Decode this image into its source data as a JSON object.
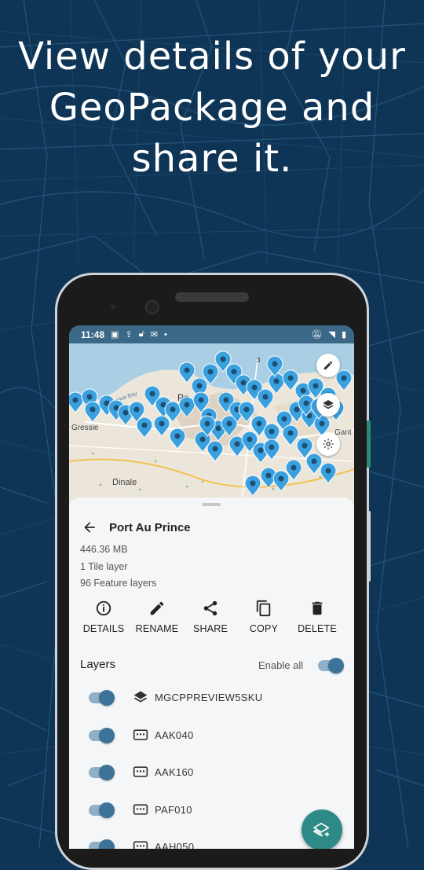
{
  "headline": {
    "line1": "View details of your",
    "line2": "GeoPackage and",
    "line3": "share it."
  },
  "status_bar": {
    "time": "11:48"
  },
  "map": {
    "labels": {
      "town1": "Po",
      "town2": "Gressie",
      "town3": "Dinale",
      "town4": "Gant",
      "road": "3",
      "bay": "Port-au-Prince Bay"
    }
  },
  "details": {
    "title": "Port Au Prince",
    "size": "446.36 MB",
    "tile_layers": "1 Tile layer",
    "feature_layers": "96 Feature layers"
  },
  "actions": [
    {
      "label": "DETAILS",
      "icon": "info-icon"
    },
    {
      "label": "RENAME",
      "icon": "pencil-icon"
    },
    {
      "label": "SHARE",
      "icon": "share-icon"
    },
    {
      "label": "COPY",
      "icon": "copy-icon"
    },
    {
      "label": "DELETE",
      "icon": "trash-icon"
    }
  ],
  "layers": {
    "heading": "Layers",
    "enable_all_label": "Enable all",
    "enable_all_on": true,
    "items": [
      {
        "name": "MGCPPREVIEW5SKU",
        "type": "tile",
        "enabled": true
      },
      {
        "name": "AAK040",
        "type": "feature",
        "enabled": true
      },
      {
        "name": "AAK160",
        "type": "feature",
        "enabled": true
      },
      {
        "name": "PAF010",
        "type": "feature",
        "enabled": true
      },
      {
        "name": "AAH050",
        "type": "feature",
        "enabled": true
      }
    ]
  },
  "colors": {
    "background": "#0f3556",
    "status_bar": "#3b6886",
    "accent": "#3d7399",
    "marker": "#3aa0de",
    "fab": "#2d8a86"
  }
}
